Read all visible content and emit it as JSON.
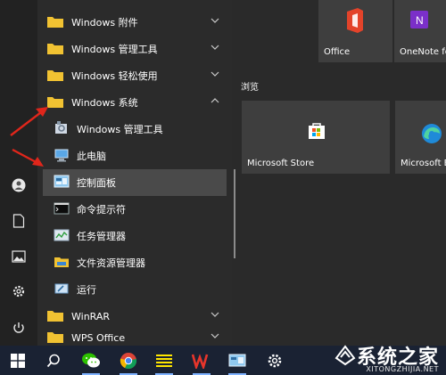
{
  "start_menu": {
    "app_list": {
      "items": [
        {
          "label": "Windows 附件",
          "type": "folder",
          "chevron": "down"
        },
        {
          "label": "Windows 管理工具",
          "type": "folder",
          "chevron": "down"
        },
        {
          "label": "Windows 轻松使用",
          "type": "folder",
          "chevron": "down"
        },
        {
          "label": "Windows 系统",
          "type": "folder",
          "chevron": "up"
        },
        {
          "label": "Windows 管理工具",
          "type": "app",
          "icon": "admin-tools-icon"
        },
        {
          "label": "此电脑",
          "type": "app",
          "icon": "this-pc-icon"
        },
        {
          "label": "控制面板",
          "type": "app",
          "icon": "control-panel-icon",
          "highlighted": true
        },
        {
          "label": "命令提示符",
          "type": "app",
          "icon": "cmd-icon"
        },
        {
          "label": "任务管理器",
          "type": "app",
          "icon": "task-manager-icon"
        },
        {
          "label": "文件资源管理器",
          "type": "app",
          "icon": "file-explorer-icon"
        },
        {
          "label": "运行",
          "type": "app",
          "icon": "run-icon"
        },
        {
          "label": "WinRAR",
          "type": "folder",
          "chevron": "down"
        },
        {
          "label": "WPS Office",
          "type": "folder",
          "chevron": "down"
        }
      ]
    },
    "tiles": {
      "group_label": "浏览",
      "items": [
        {
          "label": "Office",
          "icon": "office-icon"
        },
        {
          "label": "OneNote fo",
          "icon": "onenote-icon"
        },
        {
          "label": "Microsoft Store",
          "icon": "store-icon"
        },
        {
          "label": "Microsoft E",
          "icon": "edge-icon"
        }
      ]
    },
    "rail": [
      "user-icon",
      "documents-icon",
      "pictures-icon",
      "settings-icon",
      "power-icon"
    ]
  },
  "taskbar": {
    "items": [
      "start-button",
      "search-button",
      "wechat",
      "chrome",
      "notepad",
      "wps",
      "control-panel",
      "settings"
    ]
  },
  "colors": {
    "folder": "#f1c232",
    "highlight": "#4a4a4a",
    "arrow": "#e0261b",
    "taskbar": "#1a2233"
  },
  "watermark": {
    "main": "系统之家",
    "sub": "XITONGZHIJIA.NET"
  }
}
